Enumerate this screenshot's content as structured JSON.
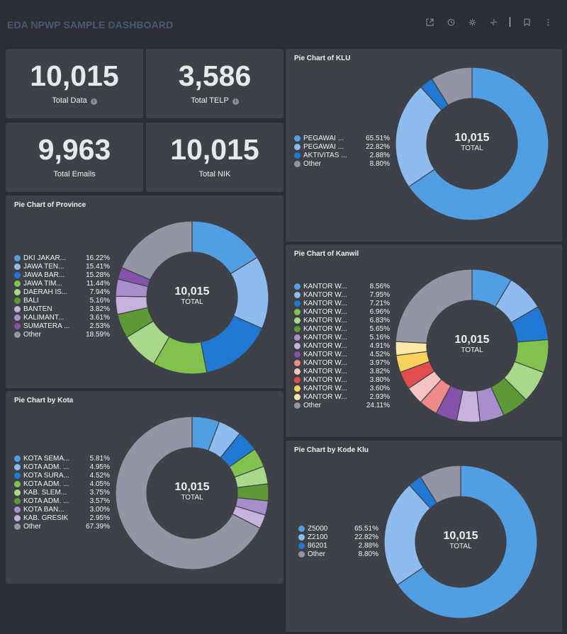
{
  "dashboard_title": "EDA NPWP SAMPLE DASHBOARD",
  "toolbar": [
    "external-link-icon",
    "clock-icon",
    "settings-icon",
    "collapse-icon",
    "bookmark-icon",
    "more-icon"
  ],
  "stats": [
    {
      "value": "10,015",
      "label": "Total Data",
      "info": true
    },
    {
      "value": "3,586",
      "label": "Total TELP",
      "info": true
    },
    {
      "value": "9,963",
      "label": "Total Emails",
      "info": false
    },
    {
      "value": "10,015",
      "label": "Total NIK",
      "info": false
    }
  ],
  "charts": [
    {
      "id": "klu",
      "title": "Pie Chart of KLU",
      "center_value": "10,015",
      "center_label": "TOTAL",
      "items": [
        {
          "name": "PEGAWAI ...",
          "pct": "65.51%",
          "value": 65.51,
          "color": "#519ee3"
        },
        {
          "name": "PEGAWAI ...",
          "pct": "22.82%",
          "value": 22.82,
          "color": "#8ebcee"
        },
        {
          "name": "AKTIVITAS ...",
          "pct": "2.88%",
          "value": 2.88,
          "color": "#1f78d1"
        },
        {
          "name": "Other",
          "pct": "8.80%",
          "value": 8.8,
          "color": "#9296a4"
        }
      ]
    },
    {
      "id": "province",
      "title": "Pie Chart of Province",
      "center_value": "10,015",
      "center_label": "TOTAL",
      "items": [
        {
          "name": "DKI JAKAR...",
          "pct": "16.22%",
          "value": 16.22,
          "color": "#519ee3"
        },
        {
          "name": "JAWA TEN...",
          "pct": "15.41%",
          "value": 15.41,
          "color": "#8ebcee"
        },
        {
          "name": "JAWA BAR...",
          "pct": "15.28%",
          "value": 15.28,
          "color": "#1f78d1"
        },
        {
          "name": "JAWA TIM...",
          "pct": "11.44%",
          "value": 11.44,
          "color": "#81c24e"
        },
        {
          "name": "DAERAH IS...",
          "pct": "7.94%",
          "value": 7.94,
          "color": "#a8d88a"
        },
        {
          "name": "BALI",
          "pct": "5.16%",
          "value": 5.16,
          "color": "#5d9a35"
        },
        {
          "name": "BANTEN",
          "pct": "3.82%",
          "value": 3.82,
          "color": "#c6b2da"
        },
        {
          "name": "KALIMANT...",
          "pct": "3.61%",
          "value": 3.61,
          "color": "#a88ecb"
        },
        {
          "name": "SUMATERA ...",
          "pct": "2.53%",
          "value": 2.53,
          "color": "#8452ab"
        },
        {
          "name": "Other",
          "pct": "18.59%",
          "value": 18.59,
          "color": "#9296a4"
        }
      ]
    },
    {
      "id": "kanwil",
      "title": "Pie Chart of Kanwil",
      "center_value": "10,015",
      "center_label": "TOTAL",
      "items": [
        {
          "name": "KANTOR W...",
          "pct": "8.56%",
          "value": 8.56,
          "color": "#519ee3"
        },
        {
          "name": "KANTOR W...",
          "pct": "7.95%",
          "value": 7.95,
          "color": "#8ebcee"
        },
        {
          "name": "KANTOR W...",
          "pct": "7.21%",
          "value": 7.21,
          "color": "#1f78d1"
        },
        {
          "name": "KANTOR W...",
          "pct": "6.96%",
          "value": 6.96,
          "color": "#81c24e"
        },
        {
          "name": "KANTOR W...",
          "pct": "6.83%",
          "value": 6.83,
          "color": "#a8d88a"
        },
        {
          "name": "KANTOR W...",
          "pct": "5.65%",
          "value": 5.65,
          "color": "#5d9a35"
        },
        {
          "name": "KANTOR W...",
          "pct": "5.16%",
          "value": 5.16,
          "color": "#a88ecb"
        },
        {
          "name": "KANTOR W...",
          "pct": "4.91%",
          "value": 4.91,
          "color": "#c6b2da"
        },
        {
          "name": "KANTOR W...",
          "pct": "4.52%",
          "value": 4.52,
          "color": "#8452ab"
        },
        {
          "name": "KANTOR W...",
          "pct": "3.97%",
          "value": 3.97,
          "color": "#ef8a8a"
        },
        {
          "name": "KANTOR W...",
          "pct": "3.82%",
          "value": 3.82,
          "color": "#f6c3c3"
        },
        {
          "name": "KANTOR W...",
          "pct": "3.80%",
          "value": 3.8,
          "color": "#e34c4c"
        },
        {
          "name": "KANTOR W...",
          "pct": "3.60%",
          "value": 3.6,
          "color": "#f8d25a"
        },
        {
          "name": "KANTOR W...",
          "pct": "2.93%",
          "value": 2.93,
          "color": "#fbe7a6"
        },
        {
          "name": "Other",
          "pct": "24.11%",
          "value": 24.11,
          "color": "#9296a4"
        }
      ]
    },
    {
      "id": "kota",
      "title": "Pie Chart by Kota",
      "center_value": "10,015",
      "center_label": "TOTAL",
      "items": [
        {
          "name": "KOTA SEMA...",
          "pct": "5.81%",
          "value": 5.81,
          "color": "#519ee3"
        },
        {
          "name": "KOTA ADM. ...",
          "pct": "4.95%",
          "value": 4.95,
          "color": "#8ebcee"
        },
        {
          "name": "KOTA SURA...",
          "pct": "4.52%",
          "value": 4.52,
          "color": "#1f78d1"
        },
        {
          "name": "KOTA ADM. ...",
          "pct": "4.05%",
          "value": 4.05,
          "color": "#81c24e"
        },
        {
          "name": "KAB. SLEM...",
          "pct": "3.75%",
          "value": 3.75,
          "color": "#a8d88a"
        },
        {
          "name": "KOTA ADM. ...",
          "pct": "3.57%",
          "value": 3.57,
          "color": "#5d9a35"
        },
        {
          "name": "KOTA BAN...",
          "pct": "3.00%",
          "value": 3.0,
          "color": "#a88ecb"
        },
        {
          "name": "KAB. GRESIK",
          "pct": "2.95%",
          "value": 2.95,
          "color": "#c6b2da"
        },
        {
          "name": "Other",
          "pct": "67.39%",
          "value": 67.39,
          "color": "#9296a4"
        }
      ]
    },
    {
      "id": "kodeklu",
      "title": "Pie Chart by Kode Klu",
      "center_value": "10,015",
      "center_label": "TOTAL",
      "items": [
        {
          "name": "Z5000",
          "pct": "65.51%",
          "value": 65.51,
          "color": "#519ee3"
        },
        {
          "name": "Z2100",
          "pct": "22.82%",
          "value": 22.82,
          "color": "#8ebcee"
        },
        {
          "name": "86201",
          "pct": "2.88%",
          "value": 2.88,
          "color": "#1f78d1"
        },
        {
          "name": "Other",
          "pct": "8.80%",
          "value": 8.8,
          "color": "#9296a4"
        }
      ]
    }
  ],
  "chart_data": [
    {
      "type": "pie",
      "title": "Pie Chart of KLU",
      "categories": [
        "PEGAWAI ...",
        "PEGAWAI ...",
        "AKTIVITAS ...",
        "Other"
      ],
      "values": [
        65.51,
        22.82,
        2.88,
        8.8
      ]
    },
    {
      "type": "pie",
      "title": "Pie Chart of Province",
      "categories": [
        "DKI JAKAR...",
        "JAWA TEN...",
        "JAWA BAR...",
        "JAWA TIM...",
        "DAERAH IS...",
        "BALI",
        "BANTEN",
        "KALIMANT...",
        "SUMATERA ...",
        "Other"
      ],
      "values": [
        16.22,
        15.41,
        15.28,
        11.44,
        7.94,
        5.16,
        3.82,
        3.61,
        2.53,
        18.59
      ]
    },
    {
      "type": "pie",
      "title": "Pie Chart of Kanwil",
      "categories": [
        "KANTOR W...",
        "KANTOR W...",
        "KANTOR W...",
        "KANTOR W...",
        "KANTOR W...",
        "KANTOR W...",
        "KANTOR W...",
        "KANTOR W...",
        "KANTOR W...",
        "KANTOR W...",
        "KANTOR W...",
        "KANTOR W...",
        "KANTOR W...",
        "KANTOR W...",
        "Other"
      ],
      "values": [
        8.56,
        7.95,
        7.21,
        6.96,
        6.83,
        5.65,
        5.16,
        4.91,
        4.52,
        3.97,
        3.82,
        3.8,
        3.6,
        2.93,
        24.11
      ]
    },
    {
      "type": "pie",
      "title": "Pie Chart by Kota",
      "categories": [
        "KOTA SEMA...",
        "KOTA ADM. ...",
        "KOTA SURA...",
        "KOTA ADM. ...",
        "KAB. SLEM...",
        "KOTA ADM. ...",
        "KOTA BAN...",
        "KAB. GRESIK",
        "Other"
      ],
      "values": [
        5.81,
        4.95,
        4.52,
        4.05,
        3.75,
        3.57,
        3.0,
        2.95,
        67.39
      ]
    },
    {
      "type": "pie",
      "title": "Pie Chart by Kode Klu",
      "categories": [
        "Z5000",
        "Z2100",
        "86201",
        "Other"
      ],
      "values": [
        65.51,
        22.82,
        2.88,
        8.8
      ]
    }
  ]
}
